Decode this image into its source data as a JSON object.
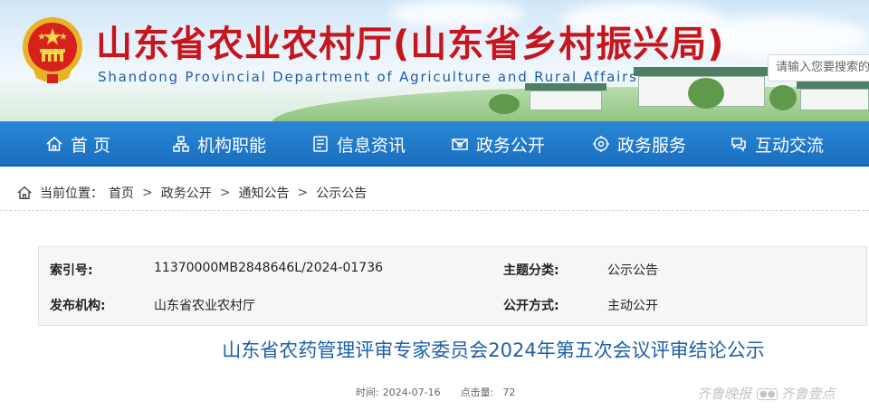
{
  "header": {
    "title": "山东省农业农村厅(山东省乡村振兴局)",
    "subtitle": "Shandong Provincial Department of Agriculture and Rural Affairs",
    "search_placeholder": "请输入您要搜索的",
    "colors": {
      "title": "#c8141b",
      "subtitle": "#1e5daa"
    }
  },
  "nav": {
    "items": [
      {
        "label": "首 页",
        "icon": "home-icon"
      },
      {
        "label": "机构职能",
        "icon": "org-icon"
      },
      {
        "label": "信息资讯",
        "icon": "news-icon"
      },
      {
        "label": "政务公开",
        "icon": "open-gov-icon"
      },
      {
        "label": "政务服务",
        "icon": "service-icon"
      },
      {
        "label": "互动交流",
        "icon": "interaction-icon"
      }
    ],
    "color": "#1a6fc0"
  },
  "breadcrumb": {
    "prefix": "当前位置：",
    "items": [
      "首页",
      "政务公开",
      "通知公告",
      "公示公告"
    ],
    "separator": ">"
  },
  "info": {
    "index_label": "索引号:",
    "index_value": "11370000MB2848646L/2024-01736",
    "category_label": "主题分类:",
    "category_value": "公示公告",
    "publisher_label": "发布机构:",
    "publisher_value": "山东省农业农村厅",
    "method_label": "公开方式:",
    "method_value": "主动公开"
  },
  "article": {
    "title": "山东省农药管理评审专家委员会2024年第五次会议评审结论公示",
    "time_label": "时间:",
    "time_value": "2024-07-16",
    "views_label": "点击量:",
    "views_value": "72",
    "title_color": "#1d5fa8"
  },
  "watermark": {
    "text_left": "齐鲁晚报",
    "text_right": "齐鲁壹点"
  }
}
